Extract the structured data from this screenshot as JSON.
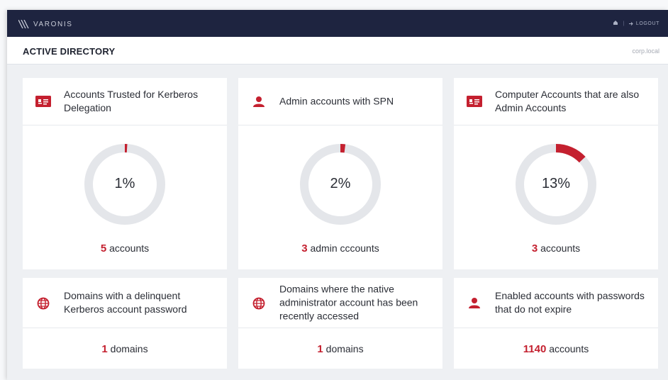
{
  "topbar": {
    "brand": "VARONIS",
    "home_icon": "home-icon",
    "separator": "|",
    "logout_icon": "logout-icon",
    "logout_label": "LOGOUT"
  },
  "header": {
    "title": "ACTIVE DIRECTORY",
    "domain": "corp.local"
  },
  "colors": {
    "accent": "#c4202f",
    "topbar": "#1e2440",
    "ring_track": "#e4e6ea"
  },
  "cards": [
    {
      "icon": "id-card-icon",
      "title": "Accounts Trusted for Kerberos Delegation",
      "percent": 0.01,
      "percent_label": "1%",
      "count": "5",
      "count_label": "accounts"
    },
    {
      "icon": "user-icon",
      "title": "Admin accounts with SPN",
      "percent": 0.02,
      "percent_label": "2%",
      "count": "3",
      "count_label": "admin cccounts"
    },
    {
      "icon": "id-card-icon",
      "title": "Computer Accounts that are also Admin Accounts",
      "percent": 0.13,
      "percent_label": "13%",
      "count": "3",
      "count_label": "accounts"
    },
    {
      "icon": "globe-icon",
      "title": "Domains with a delinquent Kerberos account password",
      "count": "1",
      "count_label": "domains"
    },
    {
      "icon": "globe-icon",
      "title": "Domains where the native administrator account has been recently accessed",
      "count": "1",
      "count_label": "domains"
    },
    {
      "icon": "user-icon",
      "title": "Enabled accounts with passwords that do not expire",
      "count": "1140",
      "count_label": "accounts"
    }
  ]
}
